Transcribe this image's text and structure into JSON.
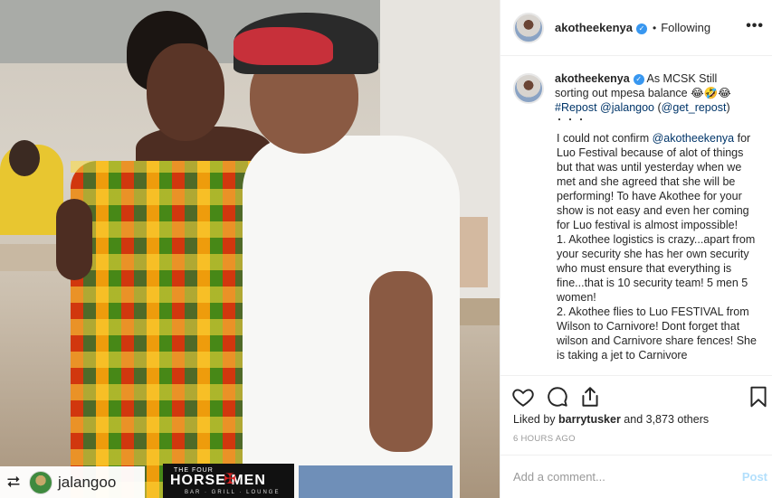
{
  "header": {
    "username": "akotheekenya",
    "separator": "•",
    "follow_status": "Following",
    "more_label": "•••"
  },
  "caption": {
    "username": "akotheekenya",
    "text": "As MCSK Still sorting out mpesa balance 😂🤣😂",
    "repost_tag": "#Repost",
    "repost_user": "@jalangoo",
    "repost_via": "(@get_repost)",
    "dots": "・・・"
  },
  "body": {
    "intro_prefix": "I could not confirm ",
    "intro_mention": "@akotheekenya",
    "intro_rest": " for Luo Festival because of alot of things but that was until yesterday when we met and she agreed that she will be performing! To have Akothee for your show is not easy and even her coming for Luo festival is almost impossible!",
    "point1": "1. Akothee logistics is crazy...apart from your security she has her own security who must ensure that everything is fine...that is 10 security team! 5 men 5 women!",
    "point2": "2. Akothee flies to Luo FESTIVAL from Wilson to Carnivore! Dont forget that wilson and Carnivore share fences! She is taking a jet to Carnivore"
  },
  "likes": {
    "prefix": "Liked by ",
    "user": "barrytusker",
    "suffix": " and 3,873 others"
  },
  "timestamp": "6 HOURS AGO",
  "add_comment": {
    "placeholder": "Add a comment...",
    "post_label": "Post"
  },
  "photo_overlay": {
    "repost_icon": "⮂",
    "repost_username": "jalangoo",
    "brand_small": "THE FOUR",
    "brand_main": "HORSE  MEN",
    "brand_sub": "BAR · GRILL · LOUNGE"
  },
  "icons": {
    "heart": "heart-icon",
    "comment": "comment-icon",
    "share": "share-icon",
    "save": "bookmark-icon"
  },
  "colors": {
    "link": "#003569",
    "verified": "#3897f0",
    "post_disabled": "#b2dffc",
    "meta_gray": "#999999"
  }
}
